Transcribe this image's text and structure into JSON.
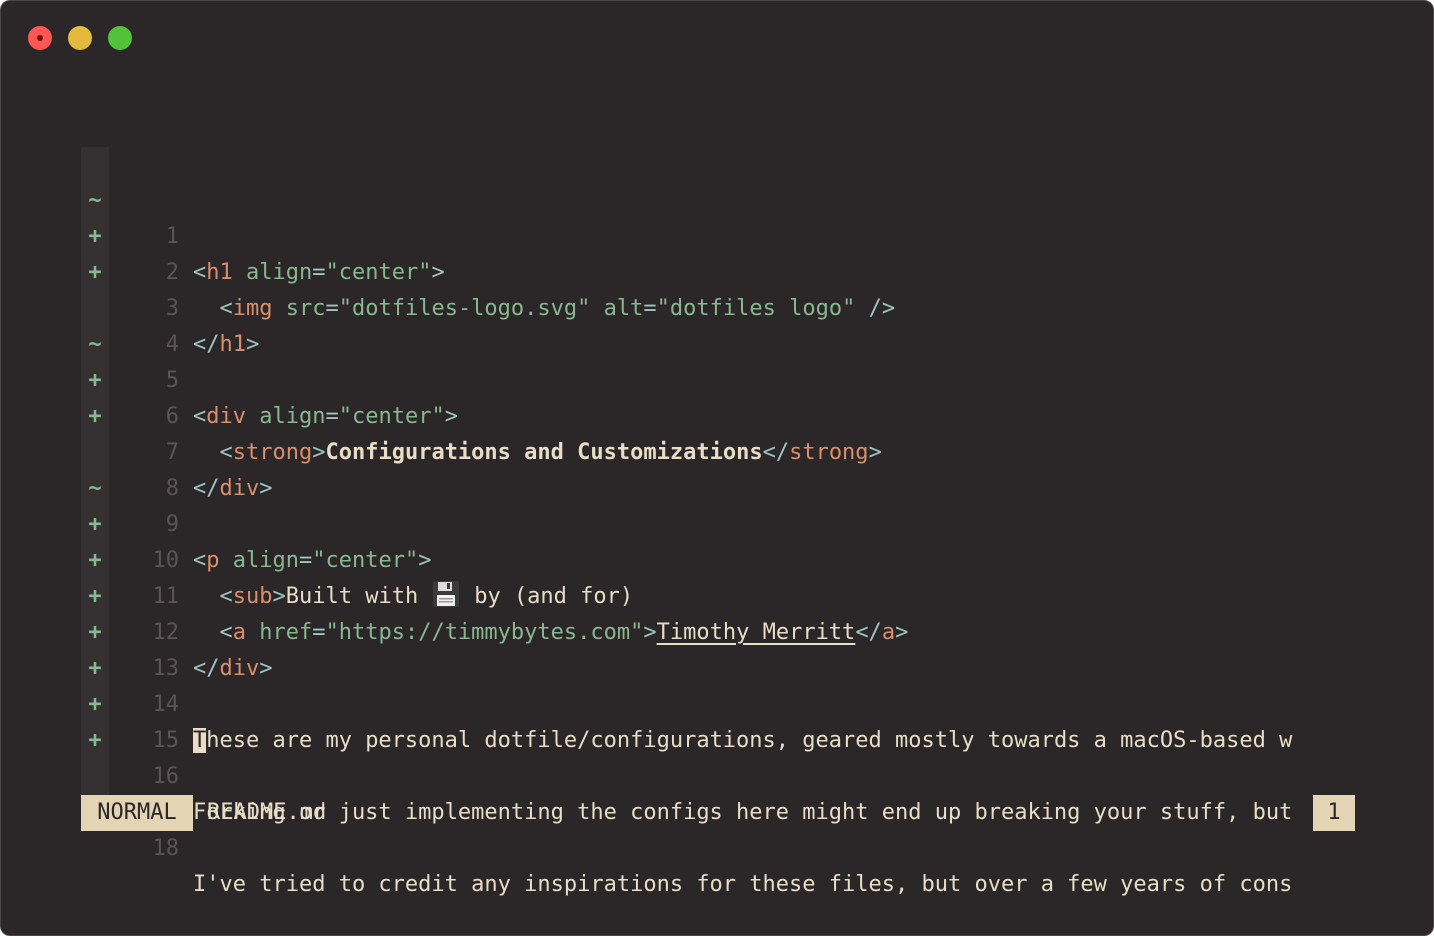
{
  "window": {
    "controls": [
      "close",
      "minimize",
      "zoom"
    ]
  },
  "editor": {
    "lines": [
      {
        "num": "1",
        "sign": "~"
      },
      {
        "num": "2",
        "sign": "+"
      },
      {
        "num": "3",
        "sign": "+"
      },
      {
        "num": "4",
        "sign": ""
      },
      {
        "num": "5",
        "sign": "~"
      },
      {
        "num": "6",
        "sign": "+"
      },
      {
        "num": "7",
        "sign": "+"
      },
      {
        "num": "8",
        "sign": ""
      },
      {
        "num": "9",
        "sign": "~"
      },
      {
        "num": "10",
        "sign": "+"
      },
      {
        "num": "11",
        "sign": "+"
      },
      {
        "num": "12",
        "sign": "+"
      },
      {
        "num": "13",
        "sign": "+"
      },
      {
        "num": "14",
        "sign": "+"
      },
      {
        "num": "15",
        "sign": "+"
      },
      {
        "num": "16",
        "sign": "+"
      },
      {
        "num": "17",
        "sign": ""
      },
      {
        "num": "18",
        "sign": ""
      }
    ],
    "code": {
      "l1": {
        "open": "<",
        "tag": "h1",
        "attr": " align",
        "eq": "=",
        "val": "\"center\"",
        "close": ">"
      },
      "l2": {
        "indent": "  ",
        "open": "<",
        "tag": "img",
        "attr1": " src",
        "eq1": "=",
        "val1": "\"dotfiles-logo.svg\"",
        "attr2": " alt",
        "eq2": "=",
        "val2": "\"dotfiles logo\"",
        "close": " />"
      },
      "l3": {
        "open": "</",
        "tag": "h1",
        "close": ">"
      },
      "l5": {
        "open": "<",
        "tag": "div",
        "attr": " align",
        "eq": "=",
        "val": "\"center\"",
        "close": ">"
      },
      "l6": {
        "indent": "  ",
        "open": "<",
        "tag": "strong",
        "close": ">",
        "text": "Configurations and Customizations",
        "open2": "</",
        "tag2": "strong",
        "close2": ">"
      },
      "l7": {
        "open": "</",
        "tag": "div",
        "close": ">"
      },
      "l9": {
        "open": "<",
        "tag": "p",
        "attr": " align",
        "eq": "=",
        "val": "\"center\"",
        "close": ">"
      },
      "l10": {
        "indent": "  ",
        "open": "<",
        "tag": "sub",
        "close": ">",
        "text1": "Built with",
        "text2": "by (and for)"
      },
      "l11": {
        "indent": "  ",
        "open": "<",
        "tag": "a",
        "attr": " href",
        "eq": "=",
        "val": "\"https://timmybytes.com\"",
        "close": ">",
        "link": "Timothy Merritt",
        "open2": "</",
        "tag2": "a",
        "close2": ">"
      },
      "l12": {
        "open": "</",
        "tag": "div",
        "close": ">"
      },
      "l14": {
        "cursor": "T",
        "text": "hese are my personal dotfile/configurations, geared mostly towards a macOS-based w"
      },
      "l16": {
        "text": "Forking or just implementing the configs here might end up breaking your stuff, but"
      },
      "l18": {
        "text": "I've tried to credit any inspirations for these files, but over a few years of cons"
      }
    }
  },
  "statusline": {
    "mode": "NORMAL",
    "filename": "README.md",
    "count": "1"
  },
  "icons": {
    "floppy": "floppy-disk-icon"
  }
}
